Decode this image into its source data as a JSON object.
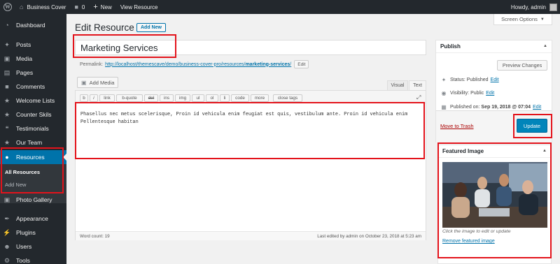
{
  "admin_bar": {
    "site_name": "Business Cover",
    "comments_count": "0",
    "new_label": "New",
    "view_resource": "View Resource",
    "howdy": "Howdy, admin"
  },
  "sidebar": {
    "items": [
      {
        "label": "Dashboard",
        "icon": "dashboard-icon"
      },
      {
        "label": "Posts",
        "icon": "pin-icon"
      },
      {
        "label": "Media",
        "icon": "media-icon"
      },
      {
        "label": "Pages",
        "icon": "pages-icon"
      },
      {
        "label": "Comments",
        "icon": "comments-icon"
      },
      {
        "label": "Welcome Lists",
        "icon": "list-icon"
      },
      {
        "label": "Counter Skils",
        "icon": "counter-icon"
      },
      {
        "label": "Testimonials",
        "icon": "quote-icon"
      },
      {
        "label": "Our Team",
        "icon": "team-icon"
      },
      {
        "label": "Resources",
        "icon": "resources-icon"
      },
      {
        "label": "Photo Gallery",
        "icon": "gallery-icon"
      },
      {
        "label": "Appearance",
        "icon": "appearance-icon"
      },
      {
        "label": "Plugins",
        "icon": "plugins-icon"
      },
      {
        "label": "Users",
        "icon": "users-icon"
      },
      {
        "label": "Tools",
        "icon": "tools-icon"
      }
    ],
    "submenu": {
      "all_resources": "All Resources",
      "add_new": "Add New"
    }
  },
  "header": {
    "title": "Edit Resource",
    "add_new": "Add New",
    "screen_options": "Screen Options"
  },
  "post": {
    "title": "Marketing Services",
    "permalink_label": "Permalink:",
    "permalink_base": "http://localhost/themescave/demo/business-cover-pro/resources/",
    "permalink_slug": "marketing-services",
    "permalink_end": "/",
    "edit_label": "Edit",
    "add_media": "Add Media",
    "tab_visual": "Visual",
    "tab_text": "Text",
    "quicktags": [
      "b",
      "i",
      "link",
      "b-quote",
      "del",
      "ins",
      "img",
      "ul",
      "ol",
      "li",
      "code",
      "more",
      "close tags"
    ],
    "content": "Phasellus nec metus scelerisque, Proin id vehicula enim feugiat est quis, vestibulum ante. Proin id vehicula enim Pellentesque habitan",
    "word_count": "Word count: 19",
    "last_edited": "Last edited by admin on October 23, 2018 at 5:23 am"
  },
  "publish": {
    "title": "Publish",
    "preview_changes": "Preview Changes",
    "status_label": "Status:",
    "status_value": "Published",
    "visibility_label": "Visibility:",
    "visibility_value": "Public",
    "published_label": "Published on:",
    "published_value": "Sep 19, 2018 @ 07:04",
    "edit_label": "Edit",
    "move_to_trash": "Move to Trash",
    "update": "Update"
  },
  "featured_image": {
    "title": "Featured Image",
    "caption": "Click the image to edit or update",
    "remove": "Remove featured image"
  },
  "colors": {
    "admin_dark": "#23282d",
    "accent_blue": "#0073aa",
    "primary_button": "#0085ba",
    "highlight_red": "#e3131b"
  }
}
